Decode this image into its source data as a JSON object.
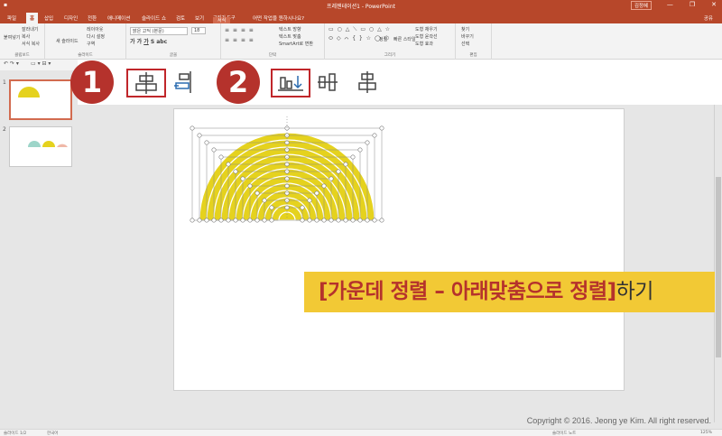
{
  "titlebar": {
    "title": "프레젠테이션1 - PowerPoint",
    "signin": "김정혜",
    "controls": [
      "—",
      "❐",
      "✕"
    ]
  },
  "tabs": {
    "items": [
      "파일",
      "홈",
      "삽입",
      "디자인",
      "전환",
      "애니메이션",
      "슬라이드 쇼",
      "검토",
      "보기"
    ],
    "active": "홈",
    "contextual_group": "그리기 도구",
    "contextual_tab": "서식",
    "tell_me": "어떤 작업을 원하시나요?",
    "share": "공유"
  },
  "ribbon": {
    "clipboard": {
      "label": "클립보드",
      "paste": "붙여넣기",
      "cut": "잘라내기",
      "copy": "복사",
      "format_painter": "서식 복사"
    },
    "slides": {
      "label": "슬라이드",
      "new_slide": "새 슬라이드",
      "layout": "레이아웃",
      "reset": "다시 설정",
      "section": "구역"
    },
    "font": {
      "label": "글꼴",
      "font_name": "맑은 고딕 (본문)",
      "font_size": "18"
    },
    "paragraph": {
      "label": "단락",
      "text_direction": "텍스트 방향",
      "align_text": "텍스트 맞춤",
      "smartart": "SmartArt로 변환"
    },
    "drawing": {
      "label": "그리기",
      "arrange": "정렬",
      "quick_styles": "빠른 스타일",
      "fill": "도형 채우기",
      "outline": "도형 윤곽선",
      "effects": "도형 효과"
    },
    "editing": {
      "label": "편집",
      "find": "찾기",
      "replace": "바꾸기",
      "select": "선택"
    }
  },
  "slides_pane": {
    "numbers": [
      "1",
      "2"
    ]
  },
  "steps": {
    "one": "1",
    "two": "2"
  },
  "caption": {
    "highlight": "[가운데 정렬 – 아래맞춤으로 정렬]",
    "tail": "하기"
  },
  "copyright": "Copyright © 2016. Jeong ye Kim. All right reserved.",
  "status": {
    "slide": "슬라이드 1/2",
    "language": "한국어",
    "notes": "슬라이드 노트",
    "zoom": "125%"
  },
  "colors": {
    "accent": "#b7472a",
    "badge": "#b5322c",
    "caption_bg": "#f2c935",
    "shape_yellow": "#e5d21e"
  }
}
